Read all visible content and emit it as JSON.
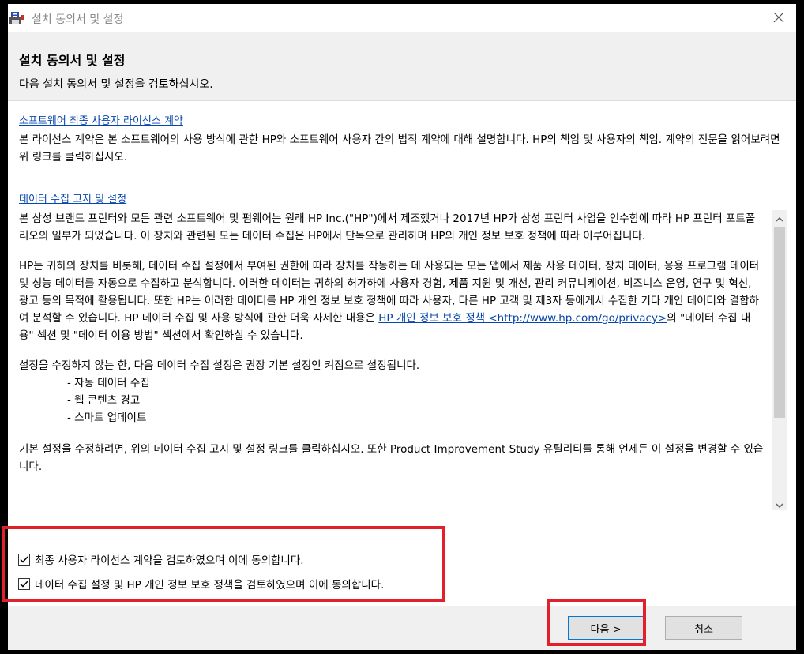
{
  "window": {
    "title": "설치 동의서 및 설정"
  },
  "header": {
    "title": "설치 동의서 및 설정",
    "subtitle": "다음 설치 동의서 및 설정을 검토하십시오."
  },
  "eula": {
    "link": "소프트웨어 최종 사용자 라이선스 계약",
    "description": "본 라이선스 계약은 본 소프트웨어의 사용 방식에 관한 HP와 소프트웨어 사용자 간의 법적 계약에 대해 설명합니다. HP의 책임 및 사용자의 책임. 계약의 전문을 읽어보려면 위 링크를 클릭하십시오."
  },
  "data_collection": {
    "link": "데이터 수집 고지 및 설정",
    "para1": "본 삼성 브랜드 프린터와 모든 관련 소프트웨어 및 펌웨어는 원래 HP Inc.(\"HP\")에서 제조했거나 2017년 HP가 삼성 프린터 사업을 인수함에 따라 HP 프린터 포트폴리오의 일부가 되었습니다.  이 장치와 관련된 모든 데이터 수집은 HP에서 단독으로 관리하며 HP의 개인 정보 보호 정책에 따라 이루어집니다.",
    "para2_before": "HP는 귀하의 장치를 비롯해, 데이터 수집 설정에서 부여된 권한에 따라 장치를 작동하는 데 사용되는 모든 앱에서 제품 사용 데이터, 장치 데이터, 응용 프로그램 데이터 및 성능 데이터를 자동으로 수집하고 분석합니다. 이러한 데이터는 귀하의 허가하에 사용자 경험, 제품 지원 및 개선, 관리 커뮤니케이션, 비즈니스 운영, 연구 및 혁신, 광고 등의 목적에 활용됩니다. 또한 HP는 이러한 데이터를 HP 개인 정보 보호 정책에 따라 사용자, 다른 HP 고객 및 제3자 등에게서 수집한 기타 개인 데이터와 결합하여 분석할 수 있습니다. HP 데이터 수집 및 사용 방식에 관한 더욱 자세한 내용은 ",
    "privacy_link": "HP 개인 정보 보호 정책 <http://www.hp.com/go/privacy>",
    "para2_after": "의 \"데이터 수집 내용\" 섹션 및 \"데이터 이용 방법\" 섹션에서 확인하실 수 있습니다.",
    "para3": "설정을 수정하지 않는 한, 다음 데이터 수집 설정은 권장 기본 설정인 켜짐으로 설정됩니다.",
    "defaults": [
      "- 자동 데이터 수집",
      "- 웹 콘텐츠 경고",
      "- 스마트 업데이트"
    ],
    "para4": "기본 설정을 수정하려면, 위의 데이터 수집 고지 및 설정 링크를 클릭하십시오.  또한 Product Improvement Study 유틸리티를 통해 언제든 이 설정을 변경할 수 있습니다."
  },
  "checkboxes": [
    {
      "label": "최종 사용자 라이선스 계약을 검토하였으며 이에 동의합니다.",
      "checked": true
    },
    {
      "label": "데이터 수집 설정 및 HP 개인 정보 보호 정책을 검토하였으며 이에 동의합니다.",
      "checked": true
    }
  ],
  "buttons": {
    "next": "다음 >",
    "cancel": "취소"
  },
  "colors": {
    "highlight": "#e0202b",
    "link": "#0645ad"
  },
  "icons": {
    "app": "printer-installer-icon",
    "close": "close-icon",
    "scroll_up": "chevron-up-icon",
    "scroll_down": "chevron-down-icon",
    "checkbox": "checkmark-icon"
  }
}
